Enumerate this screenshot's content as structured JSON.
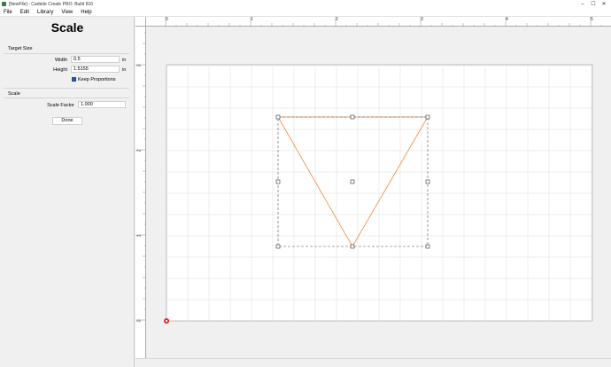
{
  "window": {
    "title": "[NewFile] - Carbide Create PRO: Build 816",
    "controls": [
      "–",
      "☐",
      "✕"
    ]
  },
  "menu": [
    "File",
    "Edit",
    "Library",
    "View",
    "Help"
  ],
  "panel": {
    "heading": "Scale",
    "target_size_label": "Target Size",
    "width_label": "Width",
    "width_value": "0.5",
    "width_unit": "in",
    "height_label": "Height",
    "height_value": "1.5155",
    "height_unit": "in",
    "keep_proportions_label": "Keep Proportions",
    "keep_proportions_checked": true,
    "scale_label": "Scale",
    "scale_factor_label": "Scale Factor",
    "scale_factor_value": "1.000",
    "done_label": "Done"
  },
  "canvas": {
    "h_ruler_labels": [
      "0",
      "1",
      "2",
      "3",
      "4",
      "5"
    ],
    "v_ruler_labels": [
      "3",
      "2",
      "1",
      "0"
    ],
    "shape_color": "#f08a3c",
    "grid_color": "#dcdcdc"
  }
}
